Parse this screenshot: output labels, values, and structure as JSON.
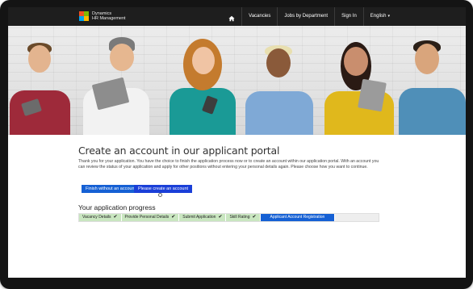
{
  "brand": {
    "line1": "Dynamics",
    "line2": "HR Management"
  },
  "nav": {
    "home_icon": "home-icon",
    "items": [
      "Vacancies",
      "Jobs by Department",
      "Sign In",
      "English"
    ],
    "language_caret": "▾"
  },
  "main": {
    "title": "Create an account in our applicant portal",
    "intro": "Thank you for your application. You have the choice to finish the application process now or to create an account within our application portal. With an account you can review the status of your application and apply for other positions without entering your personal details again. Please choose how you want to continue.",
    "buttons": {
      "finish": "Finish without an account",
      "create": "Please create an account"
    }
  },
  "progress": {
    "title": "Your application progress",
    "steps": [
      {
        "label": "Vacancy Details",
        "done": true
      },
      {
        "label": "Provide Personal Details",
        "done": true
      },
      {
        "label": "Submit Application",
        "done": true
      },
      {
        "label": "Skill Rating",
        "done": true
      },
      {
        "label": "Applicant Account Registration",
        "done": false
      }
    ],
    "check_glyph": "✔"
  },
  "colors": {
    "nav_bg": "#1e1e1e",
    "accent": "#1560d4",
    "step_done": "#c9e6c0"
  }
}
